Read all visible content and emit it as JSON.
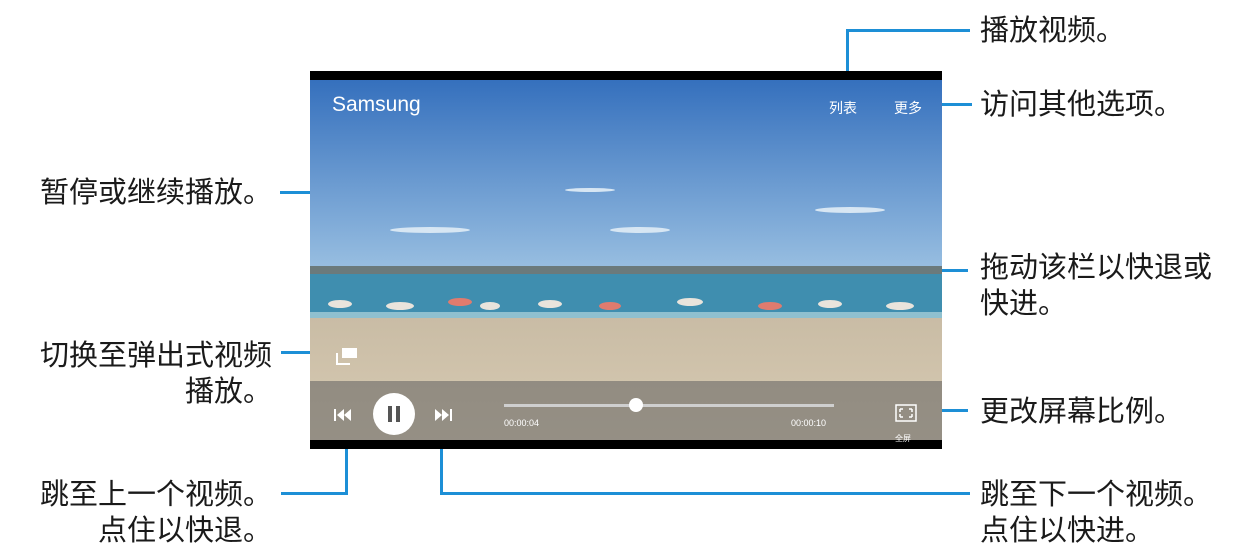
{
  "player": {
    "title": "Samsung",
    "list_label": "列表",
    "more_label": "更多",
    "current_time": "00:00:04",
    "total_time": "00:00:10",
    "progress": 0.4,
    "fullscreen_label": "全屏"
  },
  "callouts": {
    "play_video": "播放视频。",
    "more_options": "访问其他选项。",
    "pause_resume": "暂停或继续播放。",
    "drag_bar_1": "拖动该栏以快退或",
    "drag_bar_2": "快进。",
    "popup_1": "切换至弹出式视频",
    "popup_2": "播放。",
    "aspect": "更改屏幕比例。",
    "prev_1": "跳至上一个视频。",
    "prev_2": "点住以快退。",
    "next_1": "跳至下一个视频。",
    "next_2": "点住以快进。"
  },
  "colors": {
    "leader_line": "#1d8fd6",
    "sky": "#3f7fc4",
    "sea": "#3b8fb0",
    "sand": "#cdbfa6"
  }
}
